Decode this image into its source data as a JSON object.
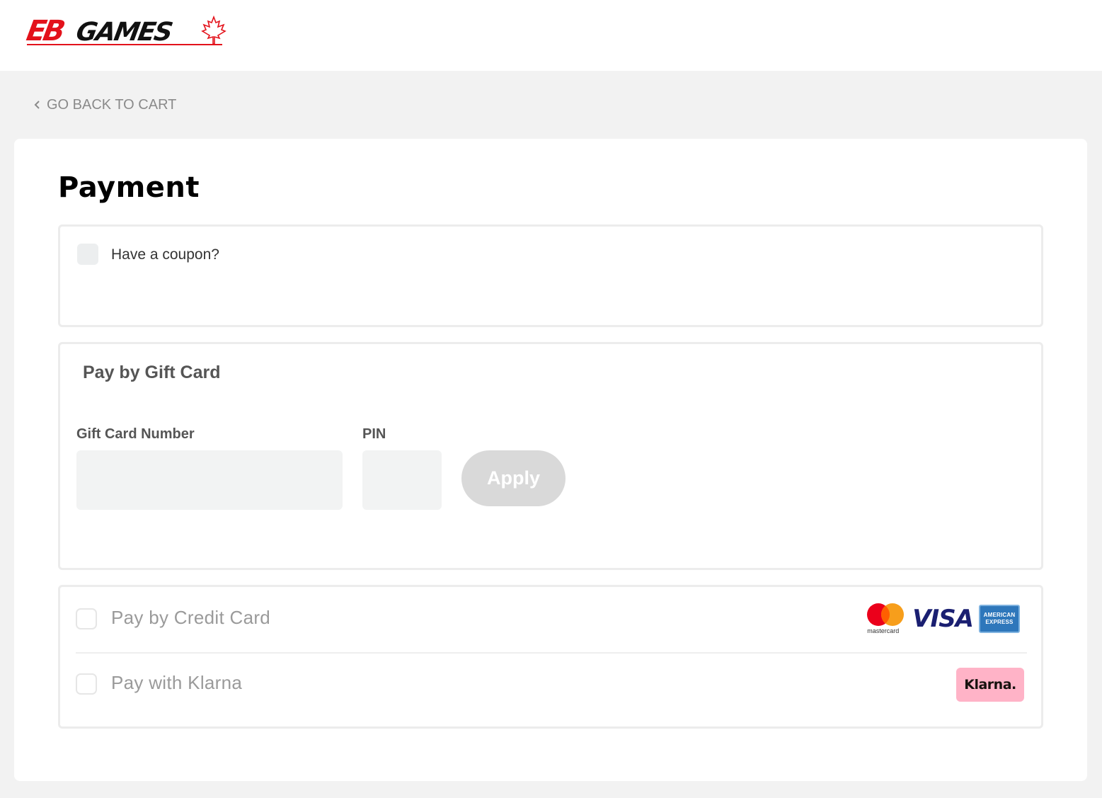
{
  "header": {
    "logo": {
      "eb": "EB",
      "games": "GAMES",
      "alt": "EB Games"
    }
  },
  "nav": {
    "back_label": "GO BACK TO CART",
    "back_icon": "chevron-left-icon"
  },
  "page": {
    "title": "Payment"
  },
  "coupon": {
    "label": "Have a coupon?",
    "checked": false
  },
  "gift_card": {
    "title": "Pay by Gift Card",
    "number_label": "Gift Card Number",
    "number_value": "",
    "pin_label": "PIN",
    "pin_value": "",
    "apply_label": "Apply"
  },
  "payment_methods": {
    "credit_card": {
      "label": "Pay by Credit Card",
      "checked": false,
      "brands": {
        "mastercard": "mastercard",
        "visa": "VISA",
        "amex_line1": "AMERICAN",
        "amex_line2": "EXPRESS"
      }
    },
    "klarna": {
      "label": "Pay with Klarna",
      "checked": false,
      "badge": "Klarna."
    }
  },
  "colors": {
    "brand_red": "#e3121b",
    "page_bg": "#f2f2f2",
    "apply_disabled": "#d9d9d9",
    "klarna_pink": "#ffb3c7",
    "visa_blue": "#1a1f71",
    "amex_blue": "#2e77bb"
  }
}
